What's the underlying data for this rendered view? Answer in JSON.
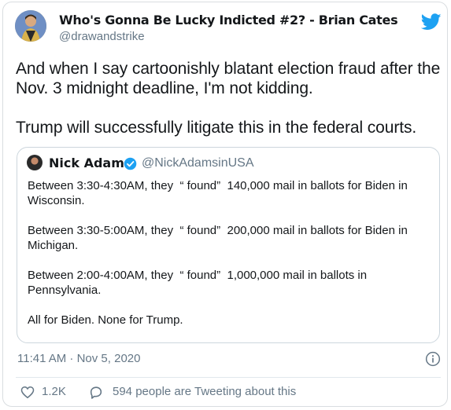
{
  "author": {
    "display_name": "Who's Gonna Be Lucky Indicted #2? - Brian Cates",
    "handle": "@drawandstrike"
  },
  "tweet": {
    "paragraphs": [
      "And when I say cartoonishly blatant election fraud after the Nov. 3 midnight deadline, I'm not kidding.",
      "Trump will successfully litigate this in the federal courts."
    ],
    "timestamp": "11:41 AM · Nov 5, 2020"
  },
  "quoted_tweet": {
    "display_name": "Nick Adams",
    "handle": "@NickAdamsinUSA",
    "paragraphs": [
      "Between 3:30-4:30AM, they  “ found”  140,000 mail in ballots for Biden in Wisconsin.",
      "Between 3:30-5:00AM, they  “ found”  200,000 mail in ballots for Biden in Michigan.",
      "Between 2:00-4:00AM, they  “ found”  1,000,000 mail in ballots in Pennsylvania.",
      "All for Biden. None for Trump."
    ]
  },
  "actions": {
    "like_count": "1.2K",
    "reply_text": "594 people are Tweeting about this"
  },
  "icons": {
    "twitter_logo": "twitter-bird-icon",
    "verified": "verified-badge-icon",
    "info": "info-icon",
    "like": "heart-icon",
    "reply": "speech-bubble-icon"
  },
  "colors": {
    "twitter_blue": "#1da1f2",
    "secondary_text": "#657786",
    "primary_text": "#14171a",
    "border": "#ccd6dd"
  }
}
